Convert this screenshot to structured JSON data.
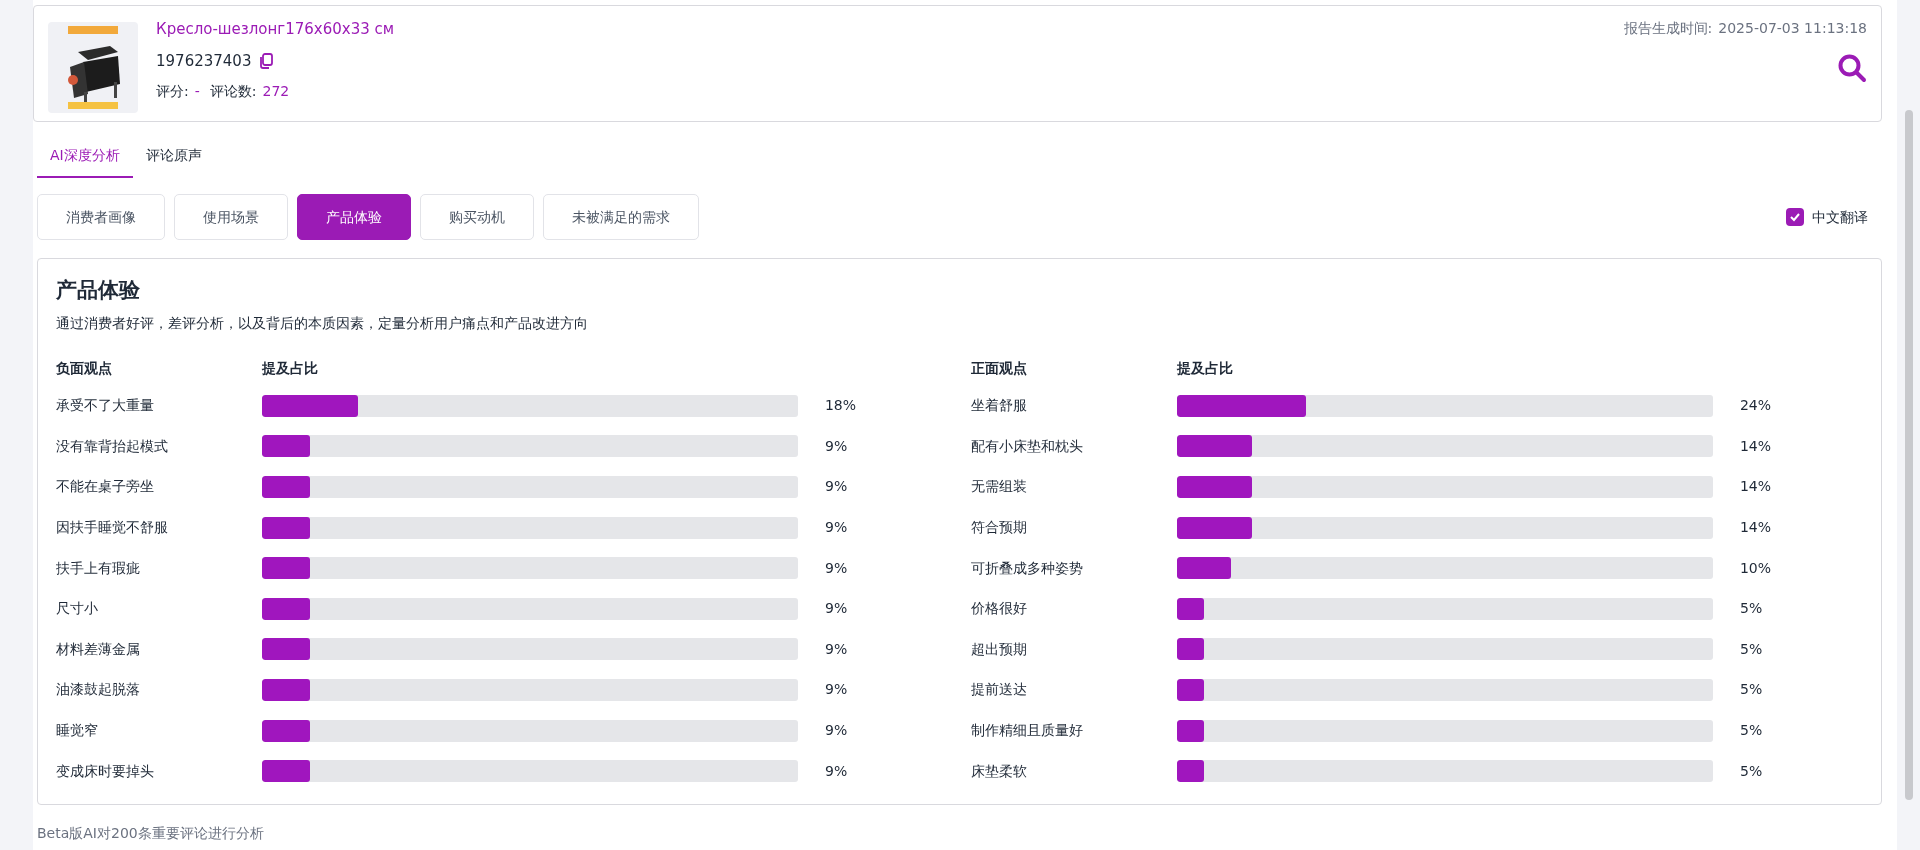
{
  "product": {
    "title": "Кресло-шезлонг176x60x33 см",
    "sku": "1976237403",
    "rating_label": "评分:",
    "rating_value": "-",
    "reviews_label": "评论数:",
    "reviews_value": "272",
    "report_time_label": "报告生成时间:",
    "report_time": "2025-07-03 11:13:18"
  },
  "tabs": [
    {
      "label": "AI深度分析",
      "selected": true
    },
    {
      "label": "评论原声",
      "selected": false
    }
  ],
  "sections": [
    {
      "label": "消费者画像",
      "selected": false
    },
    {
      "label": "使用场景",
      "selected": false
    },
    {
      "label": "产品体验",
      "selected": true
    },
    {
      "label": "购买动机",
      "selected": false
    },
    {
      "label": "未被满足的需求",
      "selected": false
    }
  ],
  "translate": {
    "label": "中文翻译",
    "checked": true
  },
  "panel": {
    "title": "产品体验",
    "description": "通过消费者好评，差评分析，以及背后的本质因素，定量分析用户痛点和产品改进方向",
    "columns": [
      {
        "heading": "负面观点",
        "share_heading": "提及占比",
        "rows": [
          {
            "label": "承受不了大重量",
            "level": 0.18,
            "reading": "18%"
          },
          {
            "label": "没有靠背抬起模式",
            "level": 0.09,
            "reading": "9%"
          },
          {
            "label": "不能在桌子旁坐",
            "level": 0.09,
            "reading": "9%"
          },
          {
            "label": "因扶手睡觉不舒服",
            "level": 0.09,
            "reading": "9%"
          },
          {
            "label": "扶手上有瑕疵",
            "level": 0.09,
            "reading": "9%"
          },
          {
            "label": "尺寸小",
            "level": 0.09,
            "reading": "9%"
          },
          {
            "label": "材料差薄金属",
            "level": 0.09,
            "reading": "9%"
          },
          {
            "label": "油漆鼓起脱落",
            "level": 0.09,
            "reading": "9%"
          },
          {
            "label": "睡觉窄",
            "level": 0.09,
            "reading": "9%"
          },
          {
            "label": "变成床时要掉头",
            "level": 0.09,
            "reading": "9%"
          }
        ]
      },
      {
        "heading": "正面观点",
        "share_heading": "提及占比",
        "rows": [
          {
            "label": "坐着舒服",
            "level": 0.24,
            "reading": "24%"
          },
          {
            "label": "配有小床垫和枕头",
            "level": 0.14,
            "reading": "14%"
          },
          {
            "label": "无需组装",
            "level": 0.14,
            "reading": "14%"
          },
          {
            "label": "符合预期",
            "level": 0.14,
            "reading": "14%"
          },
          {
            "label": "可折叠成多种姿势",
            "level": 0.1,
            "reading": "10%"
          },
          {
            "label": "价格很好",
            "level": 0.05,
            "reading": "5%"
          },
          {
            "label": "超出预期",
            "level": 0.05,
            "reading": "5%"
          },
          {
            "label": "提前送达",
            "level": 0.05,
            "reading": "5%"
          },
          {
            "label": "制作精细且质量好",
            "level": 0.05,
            "reading": "5%"
          },
          {
            "label": "床垫柔软",
            "level": 0.05,
            "reading": "5%"
          }
        ]
      }
    ]
  },
  "footer": "Beta版AI对200条重要评论进行分析"
}
